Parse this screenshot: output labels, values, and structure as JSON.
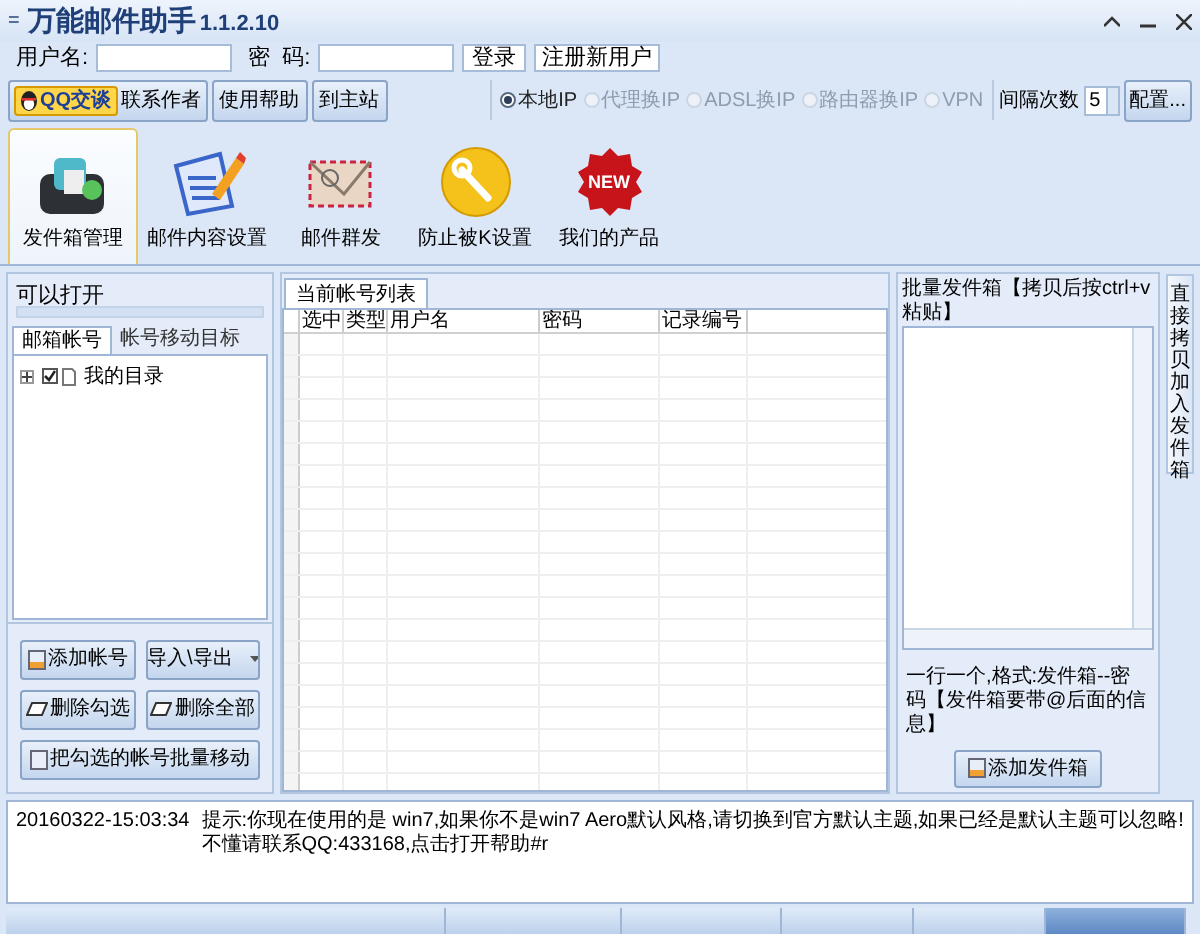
{
  "window": {
    "menu_glyph": "=",
    "title": "万能邮件助手",
    "version": "1.1.2.10"
  },
  "login": {
    "username_label": "用户名:",
    "password_label": "密  码:",
    "login_button": "登录",
    "register_button": "注册新用户"
  },
  "toolbar": {
    "qq_badge": "QQ交谈",
    "buttons": [
      "联系作者",
      "使用帮助",
      "到主站"
    ],
    "ip_options": [
      {
        "label": "本地IP",
        "selected": true,
        "disabled": false
      },
      {
        "label": "代理换IP",
        "selected": false,
        "disabled": true
      },
      {
        "label": "ADSL换IP",
        "selected": false,
        "disabled": true
      },
      {
        "label": "路由器换IP",
        "selected": false,
        "disabled": true
      },
      {
        "label": "VPN",
        "selected": false,
        "disabled": true
      }
    ],
    "interval_label": "间隔次数",
    "interval_value": "5",
    "config_button": "配置..."
  },
  "ribbon": [
    {
      "label": "发件箱管理",
      "kind": "outbox",
      "selected": true
    },
    {
      "label": "邮件内容设置",
      "kind": "edit",
      "selected": false
    },
    {
      "label": "邮件群发",
      "kind": "mail",
      "selected": false
    },
    {
      "label": "防止被K设置",
      "kind": "wrench",
      "selected": false
    },
    {
      "label": "我们的产品",
      "kind": "new",
      "badge_text": "NEW",
      "selected": false
    }
  ],
  "left_panel": {
    "title": "可以打开",
    "tabs": [
      {
        "label": "邮箱帐号",
        "selected": true
      },
      {
        "label": "帐号移动目标",
        "selected": false
      }
    ],
    "tree": [
      {
        "label": "我的目录",
        "checked": true,
        "expanded": false
      }
    ],
    "buttons": [
      {
        "label": "添加帐号",
        "kind": "add"
      },
      {
        "label": "导入\\导出",
        "kind": "dropdown"
      },
      {
        "label": "删除勾选",
        "kind": "erase"
      },
      {
        "label": "删除全部",
        "kind": "erase"
      },
      {
        "label": "把勾选的帐号批量移动",
        "kind": "move"
      }
    ]
  },
  "table": {
    "tab": "当前帐号列表",
    "columns": [
      "选中",
      "类型",
      "用户名",
      "密码",
      "记录编号"
    ]
  },
  "right_panel": {
    "title": "批量发件箱【拷贝后按ctrl+v粘贴】",
    "hint": "一行一个,格式:发件箱--密码【发件箱要带@后面的信息】",
    "add_button": "添加发件箱",
    "side_tab": "直接拷贝加入发件箱"
  },
  "log": {
    "time": "20160322-15:03:34",
    "message": "提示:你现在使用的是 win7,如果你不是win7 Aero默认风格,请切换到官方默认主题,如果已经是默认主题可以忽略!不懂请联系QQ:433168,点击打开帮助#r"
  }
}
